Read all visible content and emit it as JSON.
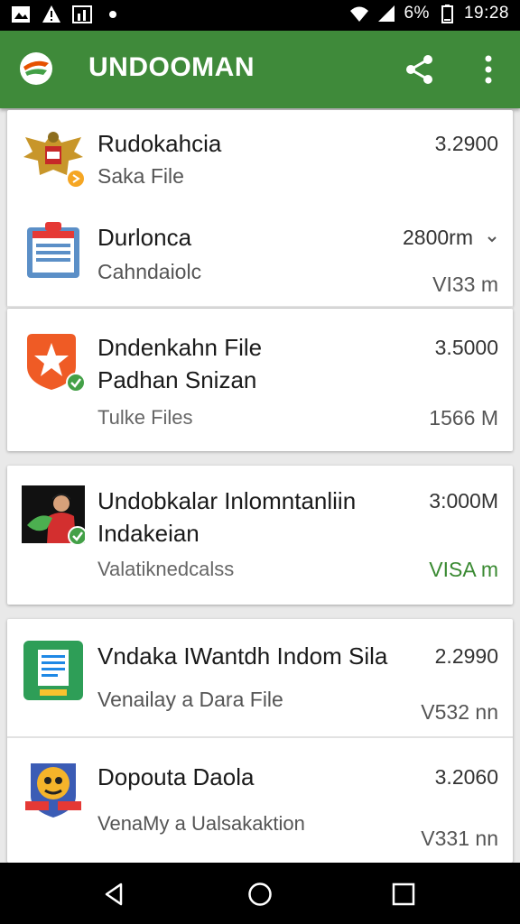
{
  "status_bar": {
    "battery": "6%",
    "time": "19:28",
    "icons": [
      "image-icon",
      "warning-icon",
      "chart-icon",
      "dot-icon",
      "wifi-icon",
      "signal-icon",
      "battery-icon"
    ]
  },
  "app_bar": {
    "title": "UNDOOMAN",
    "icons": [
      "app-logo-icon",
      "share-icon",
      "more-vert-icon"
    ],
    "color": "#3f8a3a"
  },
  "items": [
    {
      "title": "Rudokahcia",
      "subtitle": "Saka File",
      "value": "3.2900",
      "icon": "garuda-emblem-icon"
    },
    {
      "title": "Durlonca",
      "subtitle": "Cahndaiolc",
      "value": "2800rm",
      "value2": "VI33 m",
      "icon": "calendar-clipboard-icon"
    },
    {
      "title": "Dndenkahn File",
      "subtitle": "Padhan Snizan",
      "detail": "Tulke Files",
      "value": "3.5000",
      "value2": "1566 M",
      "icon": "orange-star-badge-icon"
    },
    {
      "title": "Undobkalar Inlomntanliin",
      "subtitle": "Indakeian",
      "detail": "Valatiknedcalss",
      "value": "3:000M",
      "value2": "VISA m",
      "icon": "person-photo-icon"
    },
    {
      "title": "Vndaka IWantdh Indom Sila",
      "subtitle": "Venailay a Dara File",
      "value": "2.2990",
      "value2": "V532 nn",
      "icon": "green-document-icon"
    },
    {
      "title": "Dopouta Daola",
      "subtitle": "VenaMy a Ualsakaktion",
      "value": "3.2060",
      "value2": "V331 nn",
      "icon": "badge-emblem-icon"
    }
  ],
  "nav_bar": {
    "icons": [
      "back-icon",
      "home-icon",
      "recents-icon"
    ]
  }
}
